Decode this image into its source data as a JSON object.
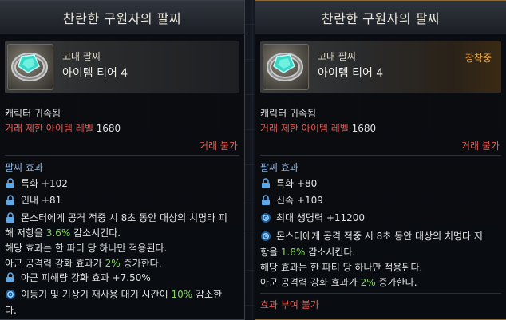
{
  "left": {
    "title": "찬란한 구원자의 팔찌",
    "grade": "고대 팔찌",
    "tier": "아이템 티어 4",
    "bound": "캐릭터 귀속됨",
    "level_label": "거래 제한 아이템 레벨",
    "level_value": "1680",
    "trade": "거래 불가",
    "effects_title": "팔찌 효과",
    "effects": [
      {
        "icon": "lock-icon",
        "text": "특화 +102"
      },
      {
        "icon": "lock-icon",
        "text": "인내 +81"
      }
    ],
    "long_line1": "몬스터에게 공격 적중 시 8초 동안 대상의 치명타 피",
    "long_line2_pre": "해 저항을 ",
    "long_line2_val": "3.6%",
    "long_line2_post": " 감소시킨다.",
    "party_line": "해당 효과는 한 파티 당 하나만 적용된다.",
    "ally_pre": "아군 공격력 강화 효과가 ",
    "ally_val": "2%",
    "ally_post": " 증가한다.",
    "dmg_line": "아군 피해량 강화 효과 +7.50%",
    "cd_pre": "이동기 및 기상기 재사용 대기 시간이 ",
    "cd_val": "10%",
    "cd_post": " 감소한",
    "cd_line2": "다."
  },
  "right": {
    "title": "찬란한 구원자의 팔찌",
    "grade": "고대 팔찌",
    "tier": "아이템 티어 4",
    "equipped": "장착중",
    "bound": "캐릭터 귀속됨",
    "level_label": "거래 제한 아이템 레벨",
    "level_value": "1680",
    "trade": "거래 불가",
    "effects_title": "팔찌 효과",
    "effects": [
      {
        "icon": "lock-icon",
        "text": "특화 +80"
      },
      {
        "icon": "lock-icon",
        "text": "신속 +109"
      },
      {
        "icon": "swirl-icon",
        "text": "최대 생명력 +11200"
      }
    ],
    "long_line1": "몬스터에게 공격 적중 시 8초 동안 대상의 치명타 저",
    "long_line2_pre": "항을 ",
    "long_line2_val": "1.8%",
    "long_line2_post": " 감소시킨다.",
    "party_line": "해당 효과는 한 파티 당 하나만 적용된다.",
    "ally_pre": "아군 공격력 강화 효과가 ",
    "ally_val": "2%",
    "ally_post": " 증가한다.",
    "grant_title": "효과 부여 불가"
  },
  "colors": {
    "red": "#e25a52",
    "green": "#7ed957",
    "section": "#8fb2d6",
    "equipped": "#e6a13a"
  }
}
